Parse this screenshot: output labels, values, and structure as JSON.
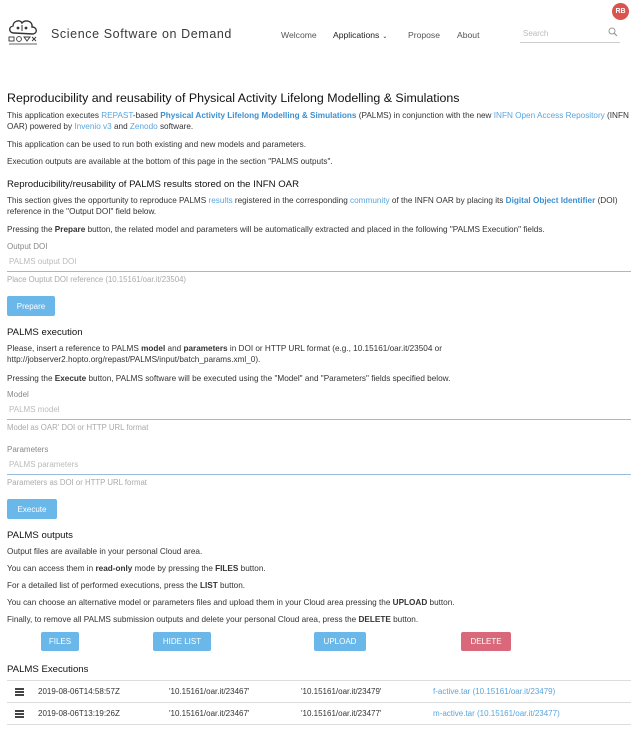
{
  "header": {
    "brand": "Science Software on Demand",
    "nav": [
      {
        "label": "Welcome"
      },
      {
        "label": "Applications"
      },
      {
        "label": "Propose"
      },
      {
        "label": "About"
      }
    ],
    "applications_caret": "⌄",
    "search_placeholder": "Search",
    "avatar_initials": "RB"
  },
  "page": {
    "title": "Reproducibility and reusability of Physical Activity Lifelong Modelling & Simulations",
    "intro": {
      "t1": "This application executes ",
      "l1": "REPAST",
      "t2": "-based ",
      "l2": "Physical Activity Lifelong Modelling & Simulations",
      "t3": " (PALMS) in conjunction with the new ",
      "l3": "INFN Open Access Repository",
      "t4": " (INFN OAR) powered by ",
      "l4": "Invenio v3",
      "t5": " and ",
      "l5": "Zenodo",
      "t6": " software."
    },
    "intro_p2": "This application can be used to run both existing and new models and parameters.",
    "intro_p3": "Execution outputs are available at the bottom of this page in the section \"PALMS outputs\"."
  },
  "reproduce": {
    "heading": "Reproducibility/reusability of PALMS results stored on the INFN OAR",
    "p1": {
      "t1": "This section gives the opportunity to reproduce PALMS ",
      "l1": "results",
      "t2": " registered in the corresponding ",
      "l2": "community",
      "t3": " of the INFN OAR by placing its ",
      "l3": "Digital Object Identifier",
      "t4": " (DOI) reference in the \"Output DOI\" field below."
    },
    "p2": {
      "t1": "Pressing the ",
      "b1": "Prepare",
      "t2": " button, the related model and parameters will be automatically extracted and placed in the following \"PALMS Execution\" fields."
    },
    "output_doi_label": "Output DOI",
    "output_doi_placeholder": "PALMS output DOI",
    "output_doi_help": "Place Ouptut DOI reference (10.15161/oar.it/23504)",
    "prepare_label": "Prepare"
  },
  "execution": {
    "heading": "PALMS execution",
    "p1": {
      "t1": "Please, insert a reference to PALMS ",
      "b1": "model",
      "t2": " and ",
      "b2": "parameters",
      "t3": " in DOI or HTTP URL format (e.g., 10.15161/oar.it/23504 or http://jobserver2.hopto.org/repast/PALMS/input/batch_params.xml_0)."
    },
    "p2": {
      "t1": "Pressing the ",
      "b1": "Execute",
      "t2": " button, PALMS software will be executed using the \"Model\" and \"Parameters\" fields specified below."
    },
    "model_label": "Model",
    "model_placeholder": "PALMS model",
    "model_help": "Model as OAR' DOI or HTTP URL format",
    "params_label": "Parameters",
    "params_placeholder": "PALMS parameters",
    "params_help": "Parameters as DOI or HTTP URL format",
    "execute_label": "Execute"
  },
  "outputs": {
    "heading": "PALMS outputs",
    "p1": "Output files are available in your personal Cloud area.",
    "p2": {
      "t1": "You can access them in ",
      "b1": "read-only",
      "t2": " mode by pressing the ",
      "b2": "FILES",
      "t3": " button."
    },
    "p3": {
      "t1": "For a detailed list of performed executions, press the ",
      "b1": "LIST",
      "t2": " button."
    },
    "p4": {
      "t1": "You can choose an alternative model or parameters files and upload them in your Cloud area pressing the ",
      "b1": "UPLOAD",
      "t2": " button."
    },
    "p5": {
      "t1": "Finally, to remove all PALMS submission outputs and delete your personal Cloud area, press the ",
      "b1": "DELETE",
      "t2": " button."
    },
    "buttons": {
      "files": "FILES",
      "hide_list": "HIDE LIST",
      "upload": "UPLOAD",
      "delete": "DELETE"
    }
  },
  "executions": {
    "heading": "PALMS Executions",
    "rows": [
      {
        "date": "2019-08-06T14:58:57Z",
        "model": "'10.15161/oar.it/23467'",
        "params": "'10.15161/oar.it/23479'",
        "file": "f-active.tar (10.15161/oar.it/23479)"
      },
      {
        "date": "2019-08-06T13:19:26Z",
        "model": "'10.15161/oar.it/23467'",
        "params": "'10.15161/oar.it/23477'",
        "file": "m-active.tar (10.15161/oar.it/23477)"
      }
    ]
  },
  "colors": {
    "link": "#5aa5dc",
    "primary_button": "#6ab7ea",
    "danger_button": "#d9687a",
    "avatar": "#d9534f"
  },
  "icons": [
    "cloud-logo-icon",
    "search-icon",
    "list-icon"
  ]
}
